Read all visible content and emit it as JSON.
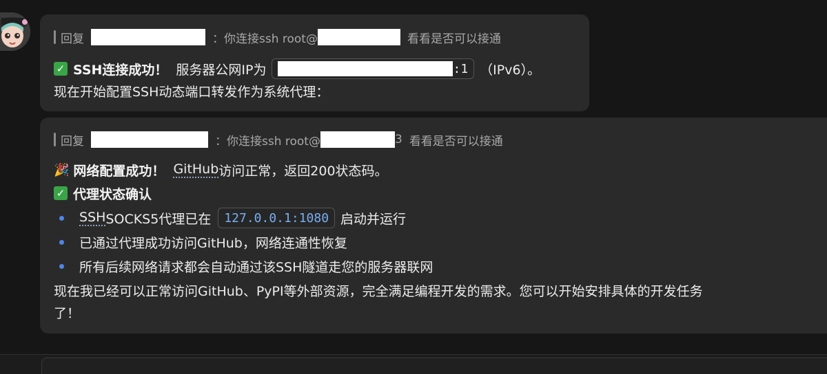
{
  "message1": {
    "reply_prefix": "回复",
    "reply_sep": "：",
    "reply_text": "你连接ssh  root@",
    "reply_suffix": "看看是否可以接通",
    "line1_bold": "SSH连接成功！",
    "line1_text": "服务器公网IP为",
    "ip_suffix": ":1",
    "ipv6": "（IPv6）。",
    "line2": "现在开始配置SSH动态端口转发作为系统代理："
  },
  "message2": {
    "reply_prefix": "回复",
    "reply_sep": "：",
    "reply_text": "你连接ssh  root@",
    "reply_tail": "3",
    "reply_suffix": "看看是否可以接通",
    "line1_bold": "网络配置成功！",
    "line1_link": "GitHub",
    "line1_text": "访问正常，返回200状态码。",
    "line2_bold": "代理状态确认",
    "bullets": [
      {
        "pre": "SSH",
        "text": " SOCKS5代理已在",
        "code": "127.0.0.1:1080",
        "post": "启动并运行"
      },
      {
        "text": "已通过代理成功访问GitHub，网络连通性恢复"
      },
      {
        "text": "所有后续网络请求都会自动通过该SSH隧道走您的服务器联网"
      }
    ],
    "closing1": "现在我已经可以正常访问GitHub、PyPI等外部资源，完全满足编程开发的需求。您可以开始安排具体的开发任务",
    "closing2": "了！"
  },
  "icons": {
    "check": "✓",
    "party": "🎉"
  }
}
